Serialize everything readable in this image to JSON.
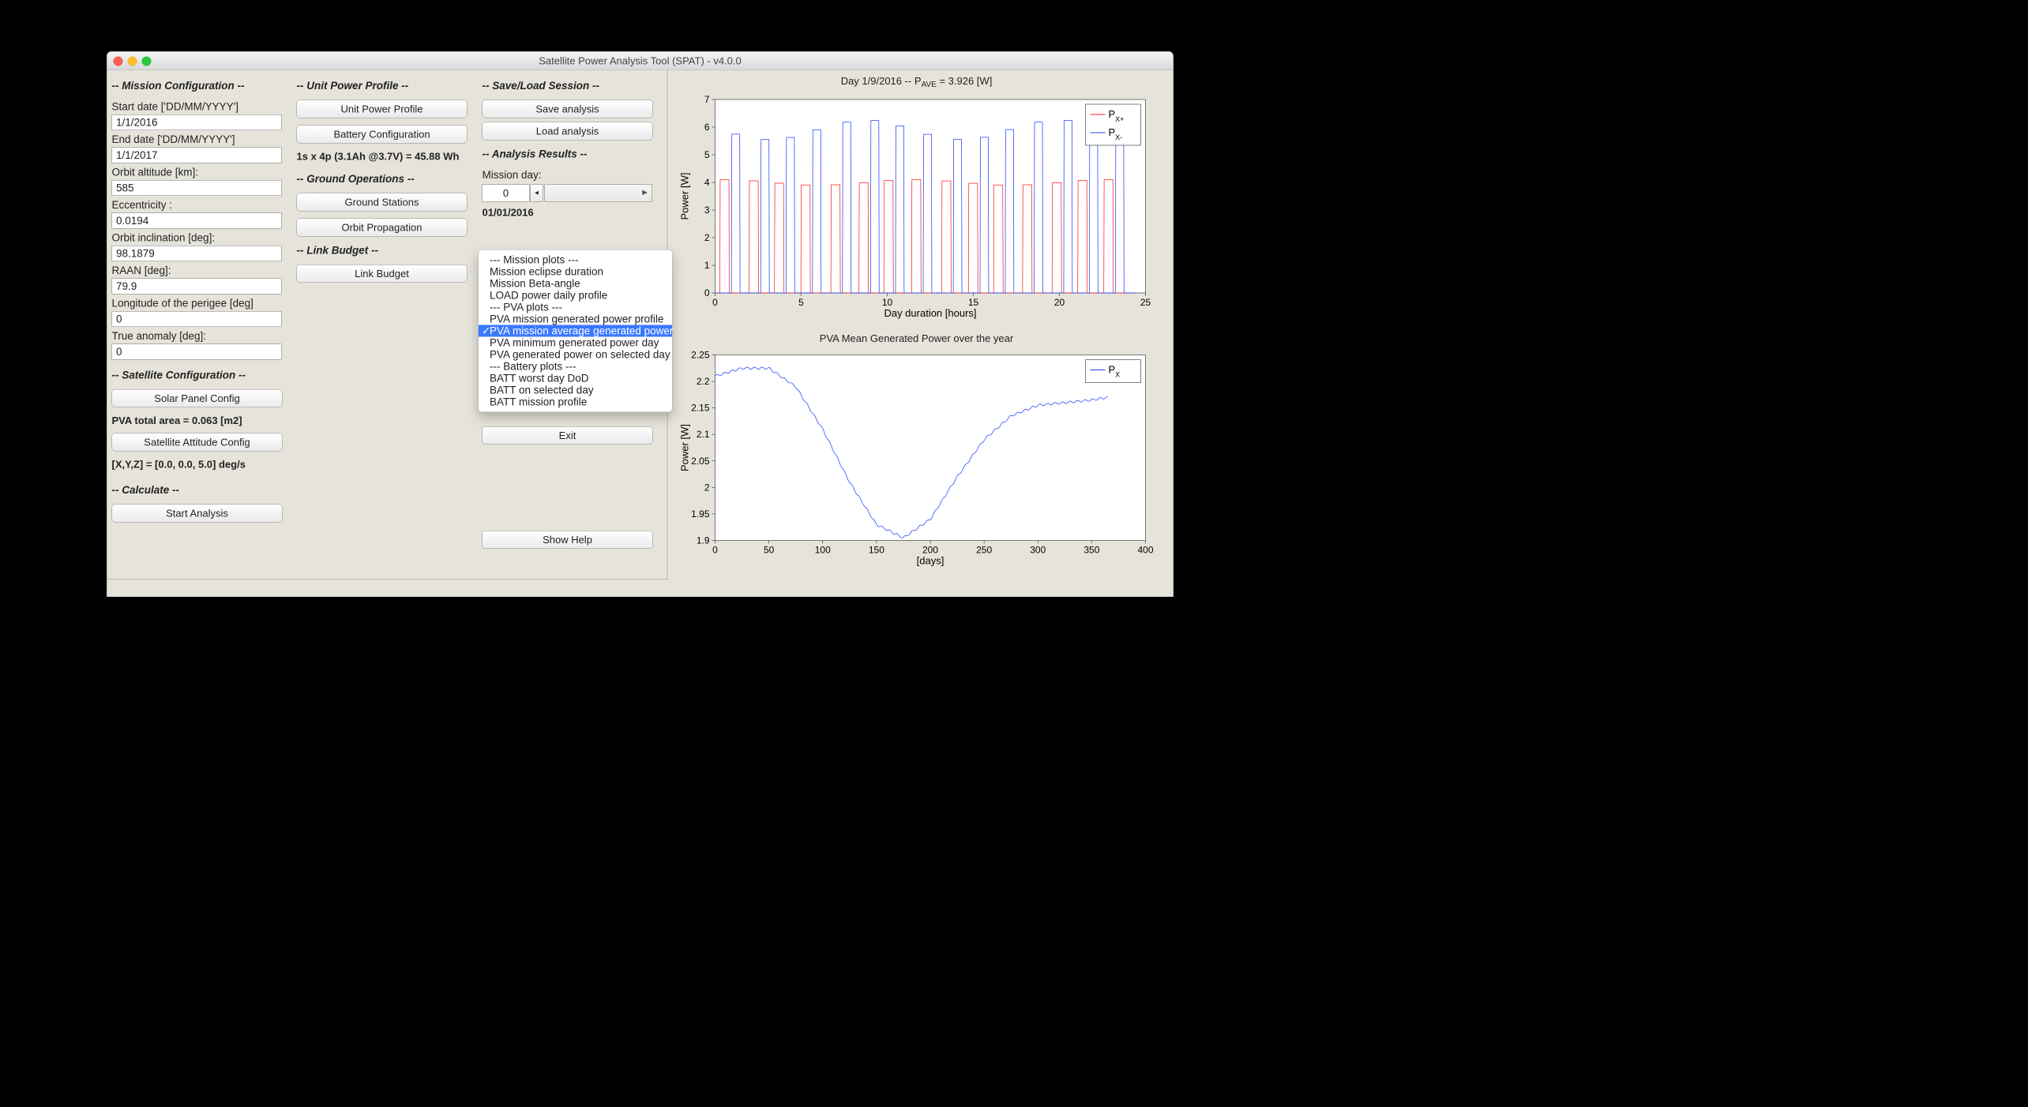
{
  "window": {
    "title": "Satellite Power Analysis Tool (SPAT) - v4.0.0"
  },
  "mission_config": {
    "heading": "-- Mission Configuration --",
    "start_label": "Start date ['DD/MM/YYYY']",
    "start_value": "1/1/2016",
    "end_label": "End date ['DD/MM/YYYY']",
    "end_value": "1/1/2017",
    "altitude_label": "Orbit altitude [km]:",
    "altitude_value": "585",
    "eccentricity_label": "Eccentricity :",
    "eccentricity_value": "0.0194",
    "inclination_label": "Orbit inclination [deg]:",
    "inclination_value": "98.1879",
    "raan_label": "RAAN [deg]:",
    "raan_value": "79.9",
    "perigee_lon_label": "Longitude of the perigee [deg]",
    "perigee_lon_value": "0",
    "true_anomaly_label": "True anomaly [deg]:",
    "true_anomaly_value": "0"
  },
  "satellite_config": {
    "heading": "-- Satellite Configuration --",
    "solar_btn": "Solar Panel Config",
    "pva_total": "PVA total area = 0.063 [m2]",
    "attitude_btn": "Satellite Attitude Config",
    "attitude_vec": "[X,Y,Z] = [0.0, 0.0, 5.0] deg/s"
  },
  "calculate": {
    "heading": "-- Calculate --",
    "start_btn": "Start Analysis"
  },
  "unit_power": {
    "heading": "-- Unit Power Profile --",
    "profile_btn": "Unit Power Profile",
    "battery_btn": "Battery Configuration",
    "battery_info": "1s x 4p (3.1Ah @3.7V) = 45.88 Wh"
  },
  "ground_ops": {
    "heading": "-- Ground Operations --",
    "stations_btn": "Ground Stations",
    "propagation_btn": "Orbit Propagation"
  },
  "link_budget": {
    "heading": "-- Link Budget --",
    "btn": "Link Budget"
  },
  "save_load": {
    "heading": "-- Save/Load Session --",
    "save_btn": "Save analysis",
    "load_btn": "Load analysis"
  },
  "results": {
    "heading": "-- Analysis Results --",
    "mission_day_label": "Mission day:",
    "mission_day_value": "0",
    "mission_day_date": "01/01/2016",
    "exit_btn": "Exit",
    "help_btn": "Show Help"
  },
  "plot_menu": {
    "items": [
      "--- Mission plots ---",
      "Mission eclipse duration",
      "Mission Beta-angle",
      "LOAD power daily profile",
      "--- PVA plots ---",
      "PVA mission generated power profile",
      "PVA mission average generated power",
      "PVA minimum generated power day",
      "PVA generated power on selected day",
      "--- Battery plots ---",
      "BATT worst day DoD",
      "BATT on selected day",
      "BATT mission profile"
    ],
    "selected_index": 6
  },
  "chart1": {
    "title_html": "Day 1/9/2016 -- P<sub>AVE</sub> = 3.926 [W]",
    "xlabel": "Day duration [hours]",
    "ylabel": "Power [W]",
    "xlim": [
      0,
      25
    ],
    "ylim": [
      0,
      7
    ],
    "xticks": [
      0,
      5,
      10,
      15,
      20,
      25
    ],
    "yticks": [
      0,
      1,
      2,
      3,
      4,
      5,
      6,
      7
    ],
    "legend": [
      {
        "name": "P_X+",
        "label_html": "P<sub>X+</sub>",
        "color": "#ff2020"
      },
      {
        "name": "P_X-",
        "label_html": "P<sub>X-</sub>",
        "color": "#2343ff"
      }
    ]
  },
  "chart2": {
    "title": "PVA Mean Generated Power over the year",
    "xlabel": "[days]",
    "ylabel": "Power [W]",
    "xlim": [
      0,
      400
    ],
    "ylim": [
      1.9,
      2.25
    ],
    "xticks": [
      0,
      50,
      100,
      150,
      200,
      250,
      300,
      350,
      400
    ],
    "yticks": [
      1.9,
      1.95,
      2.0,
      2.05,
      2.1,
      2.15,
      2.2,
      2.25
    ],
    "legend": [
      {
        "name": "P_X",
        "label_html": "P<sub>X</sub>",
        "color": "#2343ff"
      }
    ]
  },
  "chart_data": [
    {
      "id": "instantaneous_power_day",
      "type": "line",
      "title": "Day 1/9/2016 -- P_AVE = 3.926 [W]",
      "xlabel": "Day duration [hours]",
      "ylabel": "Power [W]",
      "xlim": [
        0,
        25
      ],
      "ylim": [
        0,
        7
      ],
      "note": "Two interleaved periodic pulse trains (~15 cycles over 24 h). Red (P_X+) peaks ≈ 4.0 W; Blue (P_X-) peaks ≈ 5.5–6.3 W; both drop to 0 between pulses.",
      "series": [
        {
          "name": "P_X+",
          "color": "#ff2020",
          "approx_peak_W": 4.0,
          "pulse_count_approx": 15
        },
        {
          "name": "P_X-",
          "color": "#2343ff",
          "approx_peak_W": 6.0,
          "pulse_count_approx": 15
        }
      ]
    },
    {
      "id": "pva_mean_yearly",
      "type": "line",
      "title": "PVA Mean Generated Power over the year",
      "xlabel": "[days]",
      "ylabel": "Power [W]",
      "xlim": [
        0,
        400
      ],
      "ylim": [
        1.9,
        2.25
      ],
      "series": [
        {
          "name": "P_X",
          "color": "#2343ff",
          "x": [
            0,
            25,
            50,
            75,
            100,
            125,
            150,
            175,
            200,
            225,
            250,
            275,
            300,
            325,
            350,
            365
          ],
          "y": [
            2.21,
            2.225,
            2.225,
            2.19,
            2.11,
            2.01,
            1.93,
            1.905,
            1.94,
            2.02,
            2.09,
            2.135,
            2.155,
            2.16,
            2.165,
            2.17
          ]
        }
      ]
    }
  ]
}
